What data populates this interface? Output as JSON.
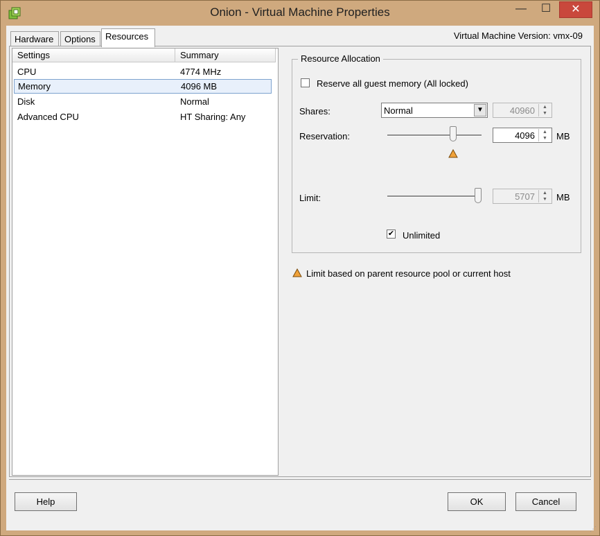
{
  "window": {
    "title": "Onion - Virtual Machine Properties",
    "minimize_glyph": "—",
    "maximize_glyph": "☐",
    "close_glyph": "✕"
  },
  "tabs": [
    {
      "label": "Hardware",
      "active": false
    },
    {
      "label": "Options",
      "active": false
    },
    {
      "label": "Resources",
      "active": true
    }
  ],
  "vm_version": "Virtual Machine Version: vmx-09",
  "settings_list": {
    "headers": [
      "Settings",
      "Summary"
    ],
    "rows": [
      {
        "setting": "CPU",
        "summary": "4774 MHz",
        "selected": false
      },
      {
        "setting": "Memory",
        "summary": "4096 MB",
        "selected": true
      },
      {
        "setting": "Disk",
        "summary": "Normal",
        "selected": false
      },
      {
        "setting": "Advanced CPU",
        "summary": "HT Sharing: Any",
        "selected": false
      }
    ]
  },
  "resource_allocation": {
    "legend": "Resource Allocation",
    "reserve_all_label": "Reserve all guest memory (All locked)",
    "reserve_all_checked": false,
    "shares_label": "Shares:",
    "shares_value": "Normal",
    "shares_number": "40960",
    "reservation_label": "Reservation:",
    "reservation_value": "4096",
    "reservation_unit": "MB",
    "reservation_fraction": 0.7,
    "limit_label": "Limit:",
    "limit_value": "5707",
    "limit_unit": "MB",
    "limit_fraction": 1.0,
    "unlimited_label": "Unlimited",
    "unlimited_checked": true
  },
  "note": "Limit based on parent resource pool or current host",
  "buttons": {
    "help": "Help",
    "ok": "OK",
    "cancel": "Cancel"
  },
  "colors": {
    "frame": "#cfa97e",
    "close": "#c9483c",
    "warning": "#f0a23a"
  }
}
